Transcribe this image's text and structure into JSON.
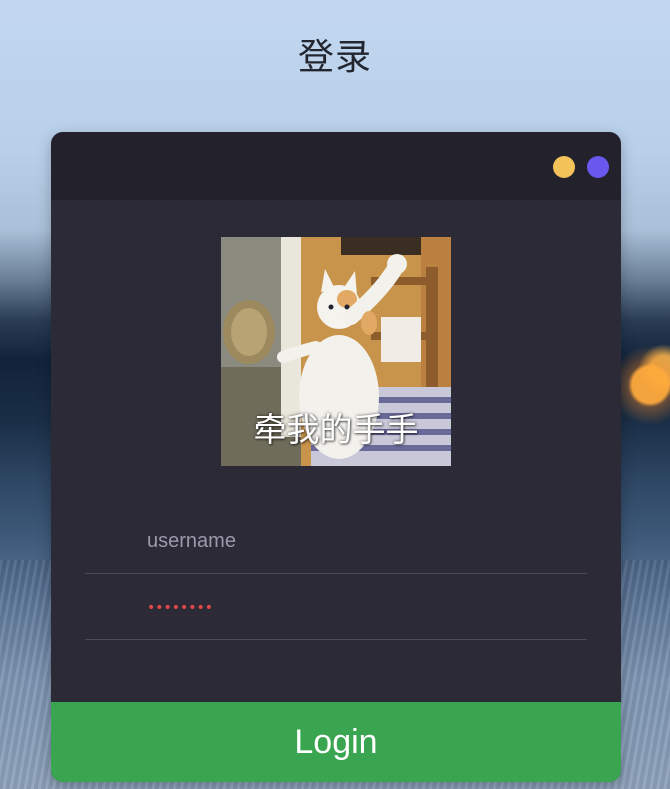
{
  "page": {
    "title": "登录"
  },
  "card": {
    "window_dots": [
      "yellow-dot",
      "purple-dot"
    ],
    "colors": {
      "yellow": "#f3c35a",
      "purple": "#6a58ee",
      "card_bg": "#2b2a36",
      "header_bg": "#22212c",
      "button_bg": "#3aa550"
    }
  },
  "avatar": {
    "caption": "牵我的手手"
  },
  "form": {
    "username_placeholder": "username",
    "password_mask": "••••••••",
    "login_label": "Login"
  }
}
